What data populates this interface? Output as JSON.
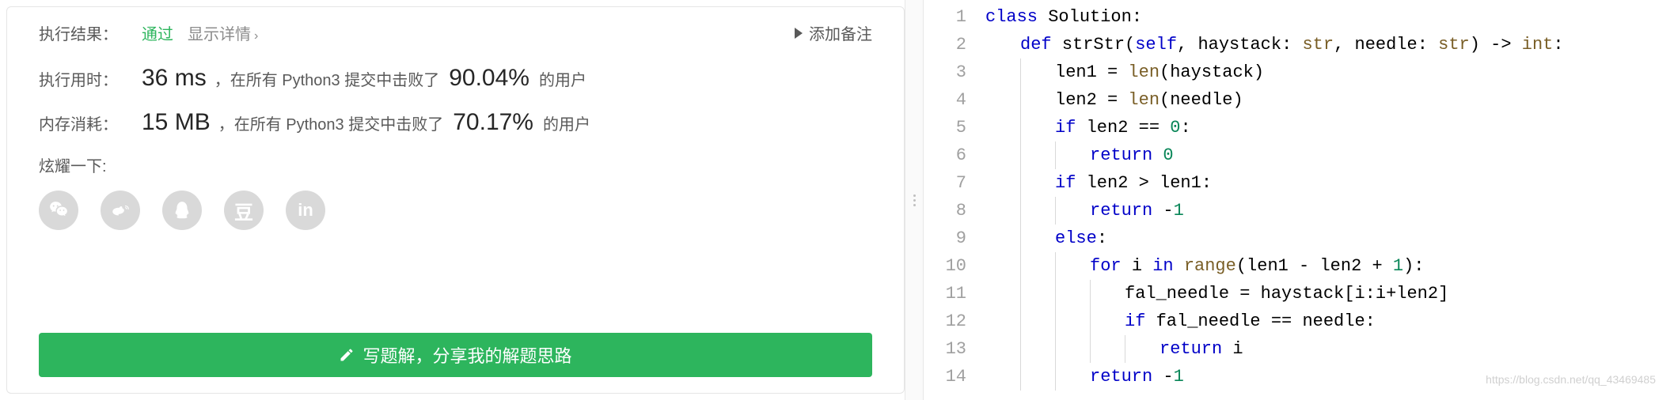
{
  "result": {
    "label": "执行结果：",
    "status": "通过",
    "showDetail": "显示详情",
    "addNote": "添加备注"
  },
  "runtime": {
    "label": "执行用时：",
    "value": "36 ms",
    "prefix": "，在所有 Python3 提交中击败了",
    "pct": "90.04%",
    "suffix": "的用户"
  },
  "memory": {
    "label": "内存消耗：",
    "value": "15 MB",
    "prefix": "，在所有 Python3 提交中击败了",
    "pct": "70.17%",
    "suffix": "的用户"
  },
  "share": {
    "label": "炫耀一下:",
    "icons": [
      "wechat",
      "weibo",
      "qq",
      "douban",
      "linkedin"
    ]
  },
  "writeButton": "写题解，分享我的解题思路",
  "code": {
    "lines": [
      {
        "n": 1,
        "indent": 0,
        "tokens": [
          [
            "kw",
            "class"
          ],
          [
            "sp",
            " "
          ],
          [
            "ident",
            "Solution"
          ],
          [
            "punc",
            ":"
          ]
        ]
      },
      {
        "n": 2,
        "indent": 1,
        "tokens": [
          [
            "kw",
            "def"
          ],
          [
            "sp",
            " "
          ],
          [
            "ident",
            "strStr"
          ],
          [
            "punc",
            "("
          ],
          [
            "self",
            "self"
          ],
          [
            "punc",
            ", "
          ],
          [
            "ident",
            "haystack"
          ],
          [
            "punc",
            ": "
          ],
          [
            "builtin",
            "str"
          ],
          [
            "punc",
            ", "
          ],
          [
            "ident",
            "needle"
          ],
          [
            "punc",
            ": "
          ],
          [
            "builtin",
            "str"
          ],
          [
            "punc",
            ") -> "
          ],
          [
            "builtin",
            "int"
          ],
          [
            "punc",
            ":"
          ]
        ]
      },
      {
        "n": 3,
        "indent": 2,
        "tokens": [
          [
            "ident",
            "len1"
          ],
          [
            "punc",
            " = "
          ],
          [
            "builtin",
            "len"
          ],
          [
            "punc",
            "("
          ],
          [
            "ident",
            "haystack"
          ],
          [
            "punc",
            ")"
          ]
        ]
      },
      {
        "n": 4,
        "indent": 2,
        "tokens": [
          [
            "ident",
            "len2"
          ],
          [
            "punc",
            " = "
          ],
          [
            "builtin",
            "len"
          ],
          [
            "punc",
            "("
          ],
          [
            "ident",
            "needle"
          ],
          [
            "punc",
            ")"
          ]
        ]
      },
      {
        "n": 5,
        "indent": 2,
        "tokens": [
          [
            "kw",
            "if"
          ],
          [
            "sp",
            " "
          ],
          [
            "ident",
            "len2"
          ],
          [
            "punc",
            " == "
          ],
          [
            "num",
            "0"
          ],
          [
            "punc",
            ":"
          ]
        ]
      },
      {
        "n": 6,
        "indent": 3,
        "tokens": [
          [
            "kw",
            "return"
          ],
          [
            "sp",
            " "
          ],
          [
            "num",
            "0"
          ]
        ]
      },
      {
        "n": 7,
        "indent": 2,
        "tokens": [
          [
            "kw",
            "if"
          ],
          [
            "sp",
            " "
          ],
          [
            "ident",
            "len2"
          ],
          [
            "punc",
            " > "
          ],
          [
            "ident",
            "len1"
          ],
          [
            "punc",
            ":"
          ]
        ]
      },
      {
        "n": 8,
        "indent": 3,
        "tokens": [
          [
            "kw",
            "return"
          ],
          [
            "sp",
            " -"
          ],
          [
            "num",
            "1"
          ]
        ]
      },
      {
        "n": 9,
        "indent": 2,
        "tokens": [
          [
            "kw",
            "else"
          ],
          [
            "punc",
            ":"
          ]
        ]
      },
      {
        "n": 10,
        "indent": 3,
        "tokens": [
          [
            "kw",
            "for"
          ],
          [
            "sp",
            " "
          ],
          [
            "ident",
            "i"
          ],
          [
            "sp",
            " "
          ],
          [
            "kw",
            "in"
          ],
          [
            "sp",
            " "
          ],
          [
            "builtin",
            "range"
          ],
          [
            "punc",
            "("
          ],
          [
            "ident",
            "len1"
          ],
          [
            "punc",
            " - "
          ],
          [
            "ident",
            "len2"
          ],
          [
            "punc",
            " + "
          ],
          [
            "num",
            "1"
          ],
          [
            "punc",
            "):"
          ]
        ]
      },
      {
        "n": 11,
        "indent": 4,
        "tokens": [
          [
            "ident",
            "fal_needle"
          ],
          [
            "punc",
            " = "
          ],
          [
            "ident",
            "haystack"
          ],
          [
            "punc",
            "["
          ],
          [
            "ident",
            "i"
          ],
          [
            "punc",
            ":"
          ],
          [
            "ident",
            "i"
          ],
          [
            "punc",
            "+"
          ],
          [
            "ident",
            "len2"
          ],
          [
            "punc",
            "]"
          ]
        ]
      },
      {
        "n": 12,
        "indent": 4,
        "tokens": [
          [
            "kw",
            "if"
          ],
          [
            "sp",
            " "
          ],
          [
            "ident",
            "fal_needle"
          ],
          [
            "punc",
            " == "
          ],
          [
            "ident",
            "needle"
          ],
          [
            "punc",
            ":"
          ]
        ]
      },
      {
        "n": 13,
        "indent": 5,
        "tokens": [
          [
            "kw",
            "return"
          ],
          [
            "sp",
            " "
          ],
          [
            "ident",
            "i"
          ]
        ]
      },
      {
        "n": 14,
        "indent": 3,
        "tokens": [
          [
            "kw",
            "return"
          ],
          [
            "sp",
            " -"
          ],
          [
            "num",
            "1"
          ]
        ]
      }
    ]
  },
  "watermark": "https://blog.csdn.net/qq_43469485"
}
